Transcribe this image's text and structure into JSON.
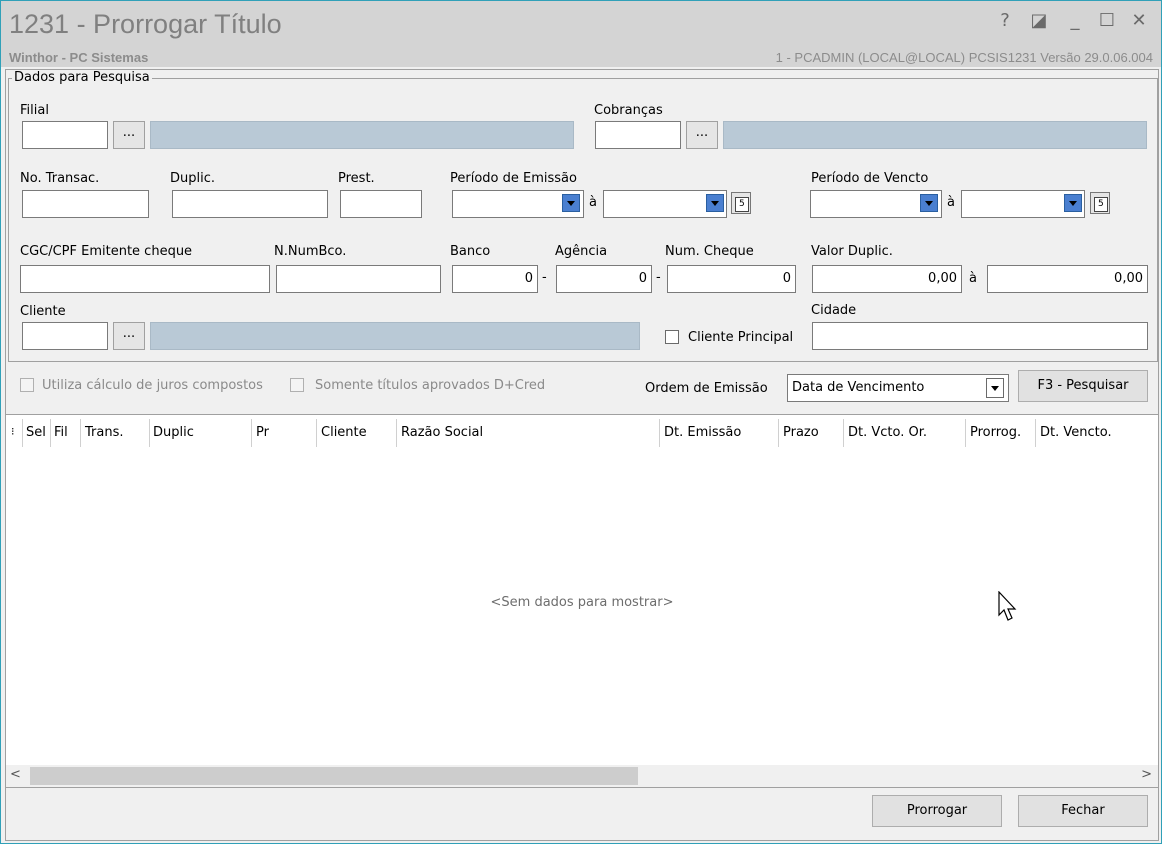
{
  "window": {
    "title": "1231 - Prorrogar Título",
    "subtitle": "Winthor - PC Sistemas",
    "session_info": "1 - PCADMIN (LOCAL@LOCAL)   PCSIS1231  Versão  29.0.06.004",
    "controls": {
      "help": "?",
      "restore_alt": "◪",
      "minimize": "_",
      "maximize": "☐",
      "close": "✕"
    }
  },
  "search": {
    "group_title": "Dados para Pesquisa",
    "filial": {
      "label": "Filial",
      "value": ""
    },
    "cobrancas": {
      "label": "Cobranças",
      "value": ""
    },
    "lookup_label": "...",
    "no_transac": {
      "label": "No. Transac.",
      "value": ""
    },
    "duplic": {
      "label": "Duplic.",
      "value": ""
    },
    "prest": {
      "label": "Prest.",
      "value": ""
    },
    "periodo_emissao": {
      "label": "Período de Emissão",
      "to": "à"
    },
    "periodo_vencto": {
      "label": "Período de Vencto",
      "to": "à"
    },
    "cgc": {
      "label": "CGC/CPF Emitente cheque",
      "value": ""
    },
    "numbco": {
      "label": "N.NumBco.",
      "value": ""
    },
    "banco": {
      "label": "Banco",
      "value": "0"
    },
    "agencia": {
      "label": "Agência",
      "value": "0"
    },
    "num_cheque": {
      "label": "Num. Cheque",
      "value": "0"
    },
    "dash": "-",
    "valor_duplic": {
      "label": "Valor Duplic.",
      "from": "0,00",
      "to_label": "à",
      "to": "0,00"
    },
    "cliente": {
      "label": "Cliente",
      "value": ""
    },
    "cliente_principal": {
      "label": "Cliente Principal",
      "checked": false
    },
    "cidade": {
      "label": "Cidade",
      "value": ""
    }
  },
  "options": {
    "juros_compostos": "Utiliza cálculo de juros compostos",
    "aprovados": "Somente títulos aprovados D+Cred",
    "ordem_label": "Ordem de Emissão",
    "ordem_value": "Data de Vencimento",
    "pesquisar_button": "F3 - Pesquisar"
  },
  "grid": {
    "columns": [
      "Sel",
      "Fil",
      "Trans.",
      "Duplic",
      "Pr",
      "Cliente",
      "Razão Social",
      "Dt. Emissão",
      "Prazo",
      "Dt. Vcto. Or.",
      "Prorrog.",
      "Dt. Vencto."
    ],
    "empty_text": "<Sem dados para mostrar>",
    "scroll_left": "<",
    "scroll_right": ">"
  },
  "footer": {
    "prorrogar_button": "Prorrogar",
    "fechar_button": "Fechar"
  },
  "colors": {
    "accent_border": "#30a0b8",
    "readonly_field": "#b9c9d6",
    "dropdown_arrow": "#4a7fd0"
  }
}
